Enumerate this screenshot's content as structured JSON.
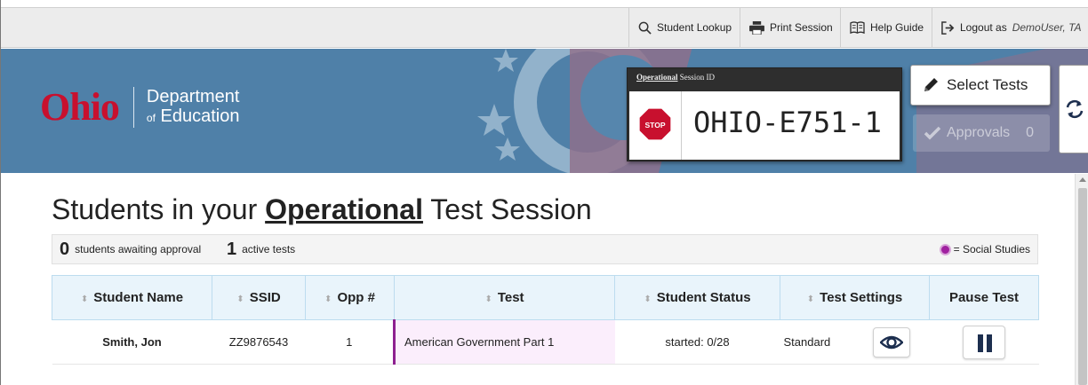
{
  "toolbar": {
    "student_lookup": "Student Lookup",
    "print_session": "Print Session",
    "help_guide": "Help Guide",
    "logout_prefix": "Logout as",
    "logout_user": "DemoUser, TA"
  },
  "banner": {
    "logo_text": "Ohio",
    "dept_line1": "Department",
    "dept_of": "of",
    "dept_line2": "Education",
    "session_label_bold": "Operational",
    "session_label_rest": "Session ID",
    "stop_text": "STOP",
    "session_id": "OHIO-E751-1",
    "select_tests": "Select Tests",
    "approvals_label": "Approvals",
    "approvals_count": "0"
  },
  "main": {
    "title_pre": "Students in your",
    "title_mode": "Operational",
    "title_post": "Test Session",
    "awaiting_count": "0",
    "awaiting_label": "students awaiting approval",
    "active_count": "1",
    "active_label": "active tests",
    "legend_label": "= Social Studies"
  },
  "table": {
    "headers": {
      "student_name": "Student Name",
      "ssid": "SSID",
      "opp": "Opp #",
      "test": "Test",
      "status": "Student Status",
      "settings": "Test Settings",
      "pause": "Pause Test"
    },
    "rows": [
      {
        "student_name": "Smith, Jon",
        "ssid": "ZZ9876543",
        "opp": "1",
        "test": "American Government Part 1",
        "status": "started: 0/28",
        "settings": "Standard"
      }
    ]
  },
  "colors": {
    "banner_bg": "#4f80a8",
    "ohio_red": "#c8102e",
    "social_studies": "#a020a0",
    "header_bg": "#e9f4fb"
  },
  "icons": [
    "search-icon",
    "printer-icon",
    "book-icon",
    "logout-icon",
    "stop-sign-icon",
    "pencil-icon",
    "check-icon",
    "refresh-icon",
    "eye-icon",
    "pause-icon",
    "sort-icon"
  ]
}
